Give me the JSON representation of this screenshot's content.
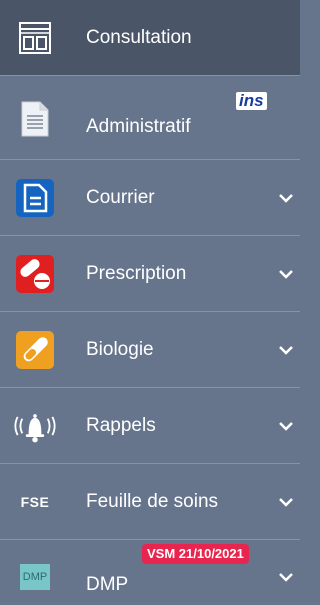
{
  "menu": {
    "items": [
      {
        "label": "Consultation",
        "icon": "consultation-layout-icon",
        "active": true
      },
      {
        "label": "Administratif",
        "icon": "document-icon",
        "badge": "ins"
      },
      {
        "label": "Courrier",
        "icon": "letter-icon",
        "expandable": true
      },
      {
        "label": "Prescription",
        "icon": "pills-icon",
        "expandable": true
      },
      {
        "label": "Biologie",
        "icon": "test-tube-icon",
        "expandable": true
      },
      {
        "label": "Rappels",
        "icon": "bell-icon",
        "expandable": true
      },
      {
        "label": "Feuille de soins",
        "icon_text": "FSE",
        "expandable": true
      },
      {
        "label": "DMP",
        "icon_text": "DMP",
        "badge": "VSM 21/10/2021",
        "expandable": true
      }
    ]
  },
  "colors": {
    "background": "#66758c",
    "active_background": "#4a5668",
    "courrier_blue": "#1565c0",
    "prescription_red": "#e02020",
    "biologie_orange": "#f0a020",
    "vsm_badge": "#e8254e",
    "dmp_teal": "#79c6c9"
  }
}
